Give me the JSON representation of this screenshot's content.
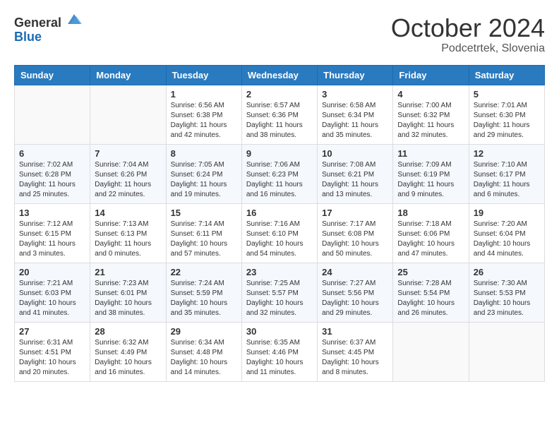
{
  "header": {
    "logo_general": "General",
    "logo_blue": "Blue",
    "title": "October 2024",
    "location": "Podcetrtek, Slovenia"
  },
  "weekdays": [
    "Sunday",
    "Monday",
    "Tuesday",
    "Wednesday",
    "Thursday",
    "Friday",
    "Saturday"
  ],
  "weeks": [
    [
      {
        "day": "",
        "sunrise": "",
        "sunset": "",
        "daylight": ""
      },
      {
        "day": "",
        "sunrise": "",
        "sunset": "",
        "daylight": ""
      },
      {
        "day": "1",
        "sunrise": "Sunrise: 6:56 AM",
        "sunset": "Sunset: 6:38 PM",
        "daylight": "Daylight: 11 hours and 42 minutes."
      },
      {
        "day": "2",
        "sunrise": "Sunrise: 6:57 AM",
        "sunset": "Sunset: 6:36 PM",
        "daylight": "Daylight: 11 hours and 38 minutes."
      },
      {
        "day": "3",
        "sunrise": "Sunrise: 6:58 AM",
        "sunset": "Sunset: 6:34 PM",
        "daylight": "Daylight: 11 hours and 35 minutes."
      },
      {
        "day": "4",
        "sunrise": "Sunrise: 7:00 AM",
        "sunset": "Sunset: 6:32 PM",
        "daylight": "Daylight: 11 hours and 32 minutes."
      },
      {
        "day": "5",
        "sunrise": "Sunrise: 7:01 AM",
        "sunset": "Sunset: 6:30 PM",
        "daylight": "Daylight: 11 hours and 29 minutes."
      }
    ],
    [
      {
        "day": "6",
        "sunrise": "Sunrise: 7:02 AM",
        "sunset": "Sunset: 6:28 PM",
        "daylight": "Daylight: 11 hours and 25 minutes."
      },
      {
        "day": "7",
        "sunrise": "Sunrise: 7:04 AM",
        "sunset": "Sunset: 6:26 PM",
        "daylight": "Daylight: 11 hours and 22 minutes."
      },
      {
        "day": "8",
        "sunrise": "Sunrise: 7:05 AM",
        "sunset": "Sunset: 6:24 PM",
        "daylight": "Daylight: 11 hours and 19 minutes."
      },
      {
        "day": "9",
        "sunrise": "Sunrise: 7:06 AM",
        "sunset": "Sunset: 6:23 PM",
        "daylight": "Daylight: 11 hours and 16 minutes."
      },
      {
        "day": "10",
        "sunrise": "Sunrise: 7:08 AM",
        "sunset": "Sunset: 6:21 PM",
        "daylight": "Daylight: 11 hours and 13 minutes."
      },
      {
        "day": "11",
        "sunrise": "Sunrise: 7:09 AM",
        "sunset": "Sunset: 6:19 PM",
        "daylight": "Daylight: 11 hours and 9 minutes."
      },
      {
        "day": "12",
        "sunrise": "Sunrise: 7:10 AM",
        "sunset": "Sunset: 6:17 PM",
        "daylight": "Daylight: 11 hours and 6 minutes."
      }
    ],
    [
      {
        "day": "13",
        "sunrise": "Sunrise: 7:12 AM",
        "sunset": "Sunset: 6:15 PM",
        "daylight": "Daylight: 11 hours and 3 minutes."
      },
      {
        "day": "14",
        "sunrise": "Sunrise: 7:13 AM",
        "sunset": "Sunset: 6:13 PM",
        "daylight": "Daylight: 11 hours and 0 minutes."
      },
      {
        "day": "15",
        "sunrise": "Sunrise: 7:14 AM",
        "sunset": "Sunset: 6:11 PM",
        "daylight": "Daylight: 10 hours and 57 minutes."
      },
      {
        "day": "16",
        "sunrise": "Sunrise: 7:16 AM",
        "sunset": "Sunset: 6:10 PM",
        "daylight": "Daylight: 10 hours and 54 minutes."
      },
      {
        "day": "17",
        "sunrise": "Sunrise: 7:17 AM",
        "sunset": "Sunset: 6:08 PM",
        "daylight": "Daylight: 10 hours and 50 minutes."
      },
      {
        "day": "18",
        "sunrise": "Sunrise: 7:18 AM",
        "sunset": "Sunset: 6:06 PM",
        "daylight": "Daylight: 10 hours and 47 minutes."
      },
      {
        "day": "19",
        "sunrise": "Sunrise: 7:20 AM",
        "sunset": "Sunset: 6:04 PM",
        "daylight": "Daylight: 10 hours and 44 minutes."
      }
    ],
    [
      {
        "day": "20",
        "sunrise": "Sunrise: 7:21 AM",
        "sunset": "Sunset: 6:03 PM",
        "daylight": "Daylight: 10 hours and 41 minutes."
      },
      {
        "day": "21",
        "sunrise": "Sunrise: 7:23 AM",
        "sunset": "Sunset: 6:01 PM",
        "daylight": "Daylight: 10 hours and 38 minutes."
      },
      {
        "day": "22",
        "sunrise": "Sunrise: 7:24 AM",
        "sunset": "Sunset: 5:59 PM",
        "daylight": "Daylight: 10 hours and 35 minutes."
      },
      {
        "day": "23",
        "sunrise": "Sunrise: 7:25 AM",
        "sunset": "Sunset: 5:57 PM",
        "daylight": "Daylight: 10 hours and 32 minutes."
      },
      {
        "day": "24",
        "sunrise": "Sunrise: 7:27 AM",
        "sunset": "Sunset: 5:56 PM",
        "daylight": "Daylight: 10 hours and 29 minutes."
      },
      {
        "day": "25",
        "sunrise": "Sunrise: 7:28 AM",
        "sunset": "Sunset: 5:54 PM",
        "daylight": "Daylight: 10 hours and 26 minutes."
      },
      {
        "day": "26",
        "sunrise": "Sunrise: 7:30 AM",
        "sunset": "Sunset: 5:53 PM",
        "daylight": "Daylight: 10 hours and 23 minutes."
      }
    ],
    [
      {
        "day": "27",
        "sunrise": "Sunrise: 6:31 AM",
        "sunset": "Sunset: 4:51 PM",
        "daylight": "Daylight: 10 hours and 20 minutes."
      },
      {
        "day": "28",
        "sunrise": "Sunrise: 6:32 AM",
        "sunset": "Sunset: 4:49 PM",
        "daylight": "Daylight: 10 hours and 16 minutes."
      },
      {
        "day": "29",
        "sunrise": "Sunrise: 6:34 AM",
        "sunset": "Sunset: 4:48 PM",
        "daylight": "Daylight: 10 hours and 14 minutes."
      },
      {
        "day": "30",
        "sunrise": "Sunrise: 6:35 AM",
        "sunset": "Sunset: 4:46 PM",
        "daylight": "Daylight: 10 hours and 11 minutes."
      },
      {
        "day": "31",
        "sunrise": "Sunrise: 6:37 AM",
        "sunset": "Sunset: 4:45 PM",
        "daylight": "Daylight: 10 hours and 8 minutes."
      },
      {
        "day": "",
        "sunrise": "",
        "sunset": "",
        "daylight": ""
      },
      {
        "day": "",
        "sunrise": "",
        "sunset": "",
        "daylight": ""
      }
    ]
  ]
}
